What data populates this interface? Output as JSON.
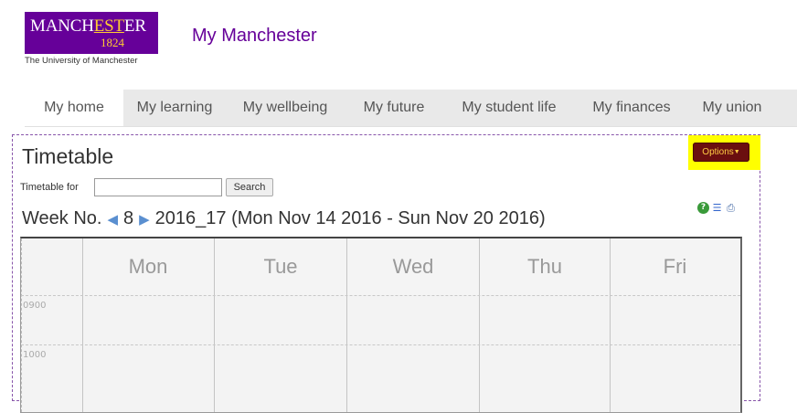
{
  "brand": {
    "logo_name_pre": "MANCH",
    "logo_name_gold": "EST",
    "logo_name_post": "ER",
    "logo_year": "1824",
    "logo_subtitle": "The University of Manchester",
    "site_title": "My Manchester",
    "primary_color": "#660099",
    "gold_color": "#ffcc33"
  },
  "nav": {
    "items": [
      {
        "label": "My home"
      },
      {
        "label": "My learning"
      },
      {
        "label": "My wellbeing"
      },
      {
        "label": "My future"
      },
      {
        "label": "My student life"
      },
      {
        "label": "My finances"
      },
      {
        "label": "My union"
      }
    ],
    "active_index": 0
  },
  "timetable": {
    "title": "Timetable",
    "options_label": "Options",
    "for_label": "Timetable for",
    "for_value": "",
    "search_label": "Search",
    "week_prefix": "Week No.",
    "week_number": "8",
    "week_range": "2016_17 (Mon Nov 14 2016 - Sun Nov 20 2016)",
    "days": [
      "Mon",
      "Tue",
      "Wed",
      "Thu",
      "Fri"
    ],
    "times": [
      "0900",
      "1000"
    ],
    "tool_icons": [
      "help-icon",
      "list-view-icon",
      "print-icon"
    ],
    "options_color": "#6b0f0f",
    "highlight_color": "#ffff00"
  }
}
